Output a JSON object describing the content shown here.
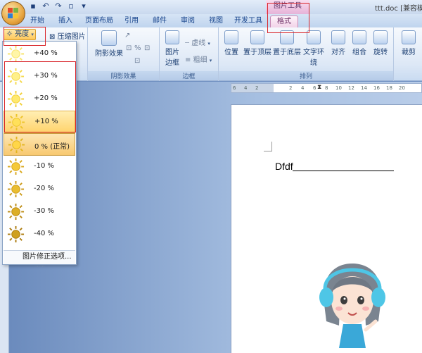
{
  "window": {
    "doc_title": "ttt.doc [兼容模",
    "contextual_group": "图片工具"
  },
  "tabs": [
    {
      "label": "开始"
    },
    {
      "label": "插入"
    },
    {
      "label": "页面布局"
    },
    {
      "label": "引用"
    },
    {
      "label": "邮件"
    },
    {
      "label": "审阅"
    },
    {
      "label": "视图"
    },
    {
      "label": "开发工具"
    },
    {
      "label": "格式",
      "active": true
    }
  ],
  "ribbon": {
    "brightness_label": "亮度",
    "compress_label": "压缩图片",
    "group_shadow": {
      "label": "阴影效果",
      "shadow_button": "阴影效果"
    },
    "group_border": {
      "label": "边框",
      "border_button": "图片边框",
      "dashes": "虚线",
      "weight": "粗细"
    },
    "group_arrange": {
      "label": "排列",
      "position": "位置",
      "bring_front": "置于顶层",
      "send_back": "置于底层",
      "text_wrap": "文字环绕",
      "align": "对齐",
      "group": "组合",
      "rotate": "旋转"
    },
    "crop_label": "裁剪"
  },
  "brightness_gallery": {
    "items": [
      {
        "label": "+40 %"
      },
      {
        "label": "+30 %"
      },
      {
        "label": "+20 %"
      },
      {
        "label": "+10 %",
        "hover": true
      },
      {
        "label": "0 % (正常)",
        "selected": true
      },
      {
        "label": "-10 %"
      },
      {
        "label": "-20 %"
      },
      {
        "label": "-30 %"
      },
      {
        "label": "-40 %"
      }
    ],
    "footer": "图片修正选项..."
  },
  "ruler": {
    "ticks": [
      "6",
      "4",
      "2",
      "2",
      "4",
      "6",
      "8",
      "10",
      "12",
      "14",
      "16",
      "18",
      "20"
    ]
  },
  "document": {
    "text": "Dfdf"
  },
  "colors": {
    "accent_highlight": "#d9262b",
    "format_tab": "#f1d3e8",
    "hover_item": "#ffd36c"
  }
}
